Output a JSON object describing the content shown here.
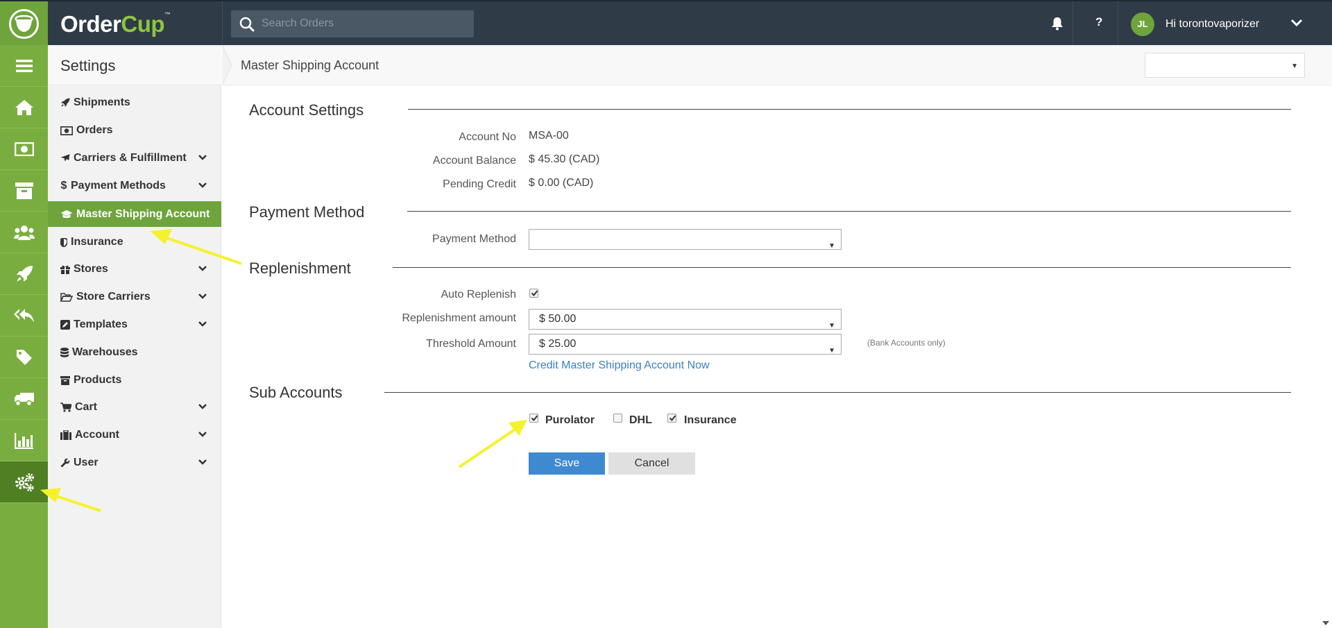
{
  "app": {
    "logo_order": "Order",
    "logo_cup": "Cup",
    "logo_tm": "™"
  },
  "topbar": {
    "search_placeholder": "Search Orders",
    "help_label": "?",
    "avatar_initials": "JL",
    "greeting": "Hi torontovaporizer"
  },
  "rail": {
    "icons": [
      "menu-icon",
      "home-icon",
      "money-icon",
      "archive-icon",
      "users-icon",
      "rocket-icon",
      "reply-all-icon",
      "tag-icon",
      "truck-icon",
      "bar-chart-icon",
      "gears-icon"
    ],
    "active": "gears-icon"
  },
  "menu": {
    "title": "Settings",
    "items": [
      {
        "label": "Shipments",
        "icon": "rocket-icon",
        "expandable": false
      },
      {
        "label": "Orders",
        "icon": "money-icon",
        "expandable": false
      },
      {
        "label": "Carriers & Fulfillment",
        "icon": "plane-icon",
        "expandable": true
      },
      {
        "label": "Payment Methods",
        "icon": "dollar-icon",
        "expandable": true
      },
      {
        "label": "Master Shipping Account",
        "icon": "graduation-cap-icon",
        "expandable": false,
        "active": true
      },
      {
        "label": "Insurance",
        "icon": "shield-icon",
        "expandable": false
      },
      {
        "label": "Stores",
        "icon": "gift-icon",
        "expandable": true
      },
      {
        "label": "Store Carriers",
        "icon": "folder-open-icon",
        "expandable": true
      },
      {
        "label": "Templates",
        "icon": "edit-icon",
        "expandable": true
      },
      {
        "label": "Warehouses",
        "icon": "database-icon",
        "expandable": false
      },
      {
        "label": "Products",
        "icon": "archive-icon",
        "expandable": false
      },
      {
        "label": "Cart",
        "icon": "cart-icon",
        "expandable": true
      },
      {
        "label": "Account",
        "icon": "briefcase-icon",
        "expandable": true
      },
      {
        "label": "User",
        "icon": "wrench-icon",
        "expandable": true
      }
    ]
  },
  "page": {
    "breadcrumb": "Master Shipping Account"
  },
  "account_settings": {
    "title": "Account Settings",
    "account_no_label": "Account No",
    "account_no_value": "MSA-00",
    "balance_label": "Account Balance",
    "balance_value": "$ 45.30 (CAD)",
    "pending_label": "Pending Credit",
    "pending_value": "$ 0.00 (CAD)"
  },
  "payment_method": {
    "title": "Payment Method",
    "label": "Payment Method",
    "value": ""
  },
  "replenishment": {
    "title": "Replenishment",
    "auto_label": "Auto Replenish",
    "auto_checked": true,
    "amount_label": "Replenishment amount",
    "amount_value": "$ 50.00",
    "threshold_label": "Threshold Amount",
    "threshold_value": "$ 25.00",
    "bank_note": "(Bank Accounts only)",
    "credit_link": "Credit Master Shipping Account Now"
  },
  "sub_accounts": {
    "title": "Sub Accounts",
    "items": [
      {
        "label": "Purolator",
        "checked": true
      },
      {
        "label": "DHL",
        "checked": false
      },
      {
        "label": "Insurance",
        "checked": true
      }
    ]
  },
  "actions": {
    "save": "Save",
    "cancel": "Cancel"
  },
  "colors": {
    "brand_green": "#6ea43b",
    "rail_green": "#7aad3f",
    "active_rail": "#4f7f22",
    "topbar": "#2f3b47",
    "save_blue": "#3f89d0",
    "link_blue": "#3a7fc1",
    "annotation_yellow": "#f5f22a"
  }
}
